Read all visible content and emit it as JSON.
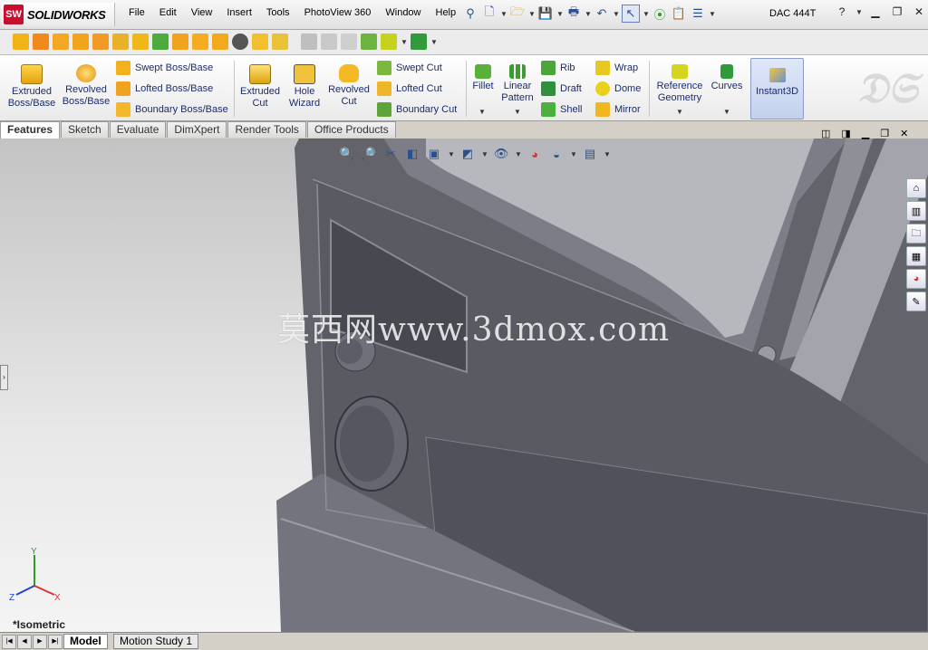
{
  "app": {
    "brand": "SOLIDWORKS",
    "logo_badge": "SW",
    "document": "DAC 444T"
  },
  "menus": [
    "File",
    "Edit",
    "View",
    "Insert",
    "Tools",
    "PhotoView 360",
    "Window",
    "Help"
  ],
  "command_manager": {
    "extruded_boss": "Extruded Boss/Base",
    "revolved_boss": "Revolved Boss/Base",
    "swept_boss": "Swept Boss/Base",
    "lofted_boss": "Lofted Boss/Base",
    "boundary_boss": "Boundary Boss/Base",
    "extruded_cut": "Extruded Cut",
    "hole_wizard": "Hole Wizard",
    "revolved_cut": "Revolved Cut",
    "swept_cut": "Swept Cut",
    "lofted_cut": "Lofted Cut",
    "boundary_cut": "Boundary Cut",
    "fillet": "Fillet",
    "linear_pattern": "Linear Pattern",
    "rib": "Rib",
    "draft": "Draft",
    "shell": "Shell",
    "wrap": "Wrap",
    "dome": "Dome",
    "mirror": "Mirror",
    "reference_geometry": "Reference Geometry",
    "curves": "Curves",
    "instant3d": "Instant3D"
  },
  "tabs": [
    "Features",
    "Sketch",
    "Evaluate",
    "DimXpert",
    "Render Tools",
    "Office Products"
  ],
  "active_tab": "Features",
  "viewport": {
    "watermark": "莫西网www.3dmox.com",
    "view_name": "*Isometric",
    "triad": {
      "x": "X",
      "y": "Y",
      "z": "Z"
    }
  },
  "bottom_tabs": [
    "Model",
    "Motion Study 1"
  ],
  "colors": {
    "accent": "#1b2c6b",
    "model_face": "#6e6f78",
    "model_dark": "#4a4b53",
    "background_top": "#c3c3c3"
  }
}
